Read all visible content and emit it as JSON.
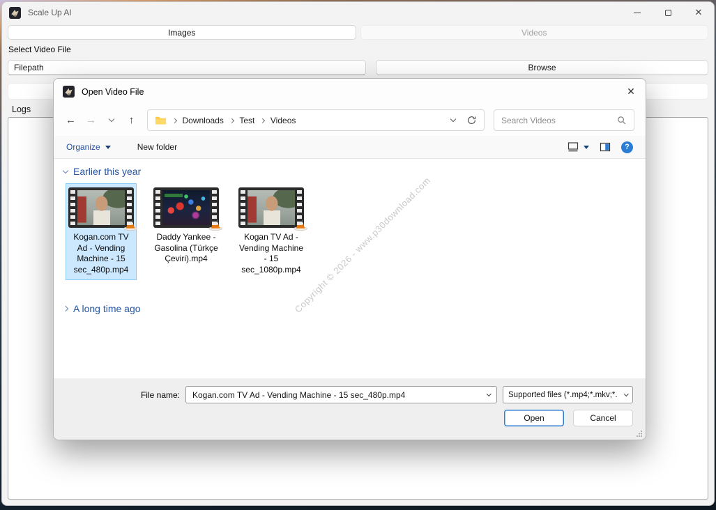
{
  "app": {
    "title": "Scale Up AI",
    "tabs": {
      "images": "Images",
      "videos": "Videos"
    },
    "select_label": "Select Video File",
    "filepath_value": "Filepath",
    "browse_label": "Browse",
    "logs_label": "Logs"
  },
  "dialog": {
    "title": "Open Video File",
    "breadcrumb": [
      "Downloads",
      "Test",
      "Videos"
    ],
    "search_placeholder": "Search Videos",
    "toolbar": {
      "organize": "Organize",
      "new_folder": "New folder"
    },
    "groups": {
      "recent": {
        "label": "Earlier this year",
        "expanded": true
      },
      "old": {
        "label": "A long time ago",
        "expanded": false
      }
    },
    "files": [
      {
        "name": "Kogan.com TV Ad - Vending Machine - 15 sec_480p.mp4",
        "selected": true,
        "thumb": "street-scene"
      },
      {
        "name": "Daddy Yankee - Gasolina (Türkçe Çeviri).mp4",
        "selected": false,
        "thumb": "night-lights"
      },
      {
        "name": "Kogan TV Ad - Vending Machine - 15 sec_1080p.mp4",
        "selected": false,
        "thumb": "street-scene"
      }
    ],
    "watermark": "Copyright © 2026 - www.p30download.com",
    "footer": {
      "file_name_label": "File name:",
      "file_name_value": "Kogan.com TV Ad - Vending Machine - 15 sec_480p.mp4",
      "file_type_value": "Supported files (*.mp4;*.mkv;*.",
      "open_label": "Open",
      "cancel_label": "Cancel"
    }
  },
  "icons": {
    "close": "✕",
    "back": "←",
    "forward": "→",
    "up": "↑",
    "help": "?"
  },
  "colors": {
    "accent_blue": "#2456a5",
    "selection_fill": "#cce8ff",
    "selection_border": "#8ecbf5",
    "open_button_border": "#2f7cd3",
    "help_icon": "#2a7cd4",
    "cone_orange": "#e8790f"
  }
}
